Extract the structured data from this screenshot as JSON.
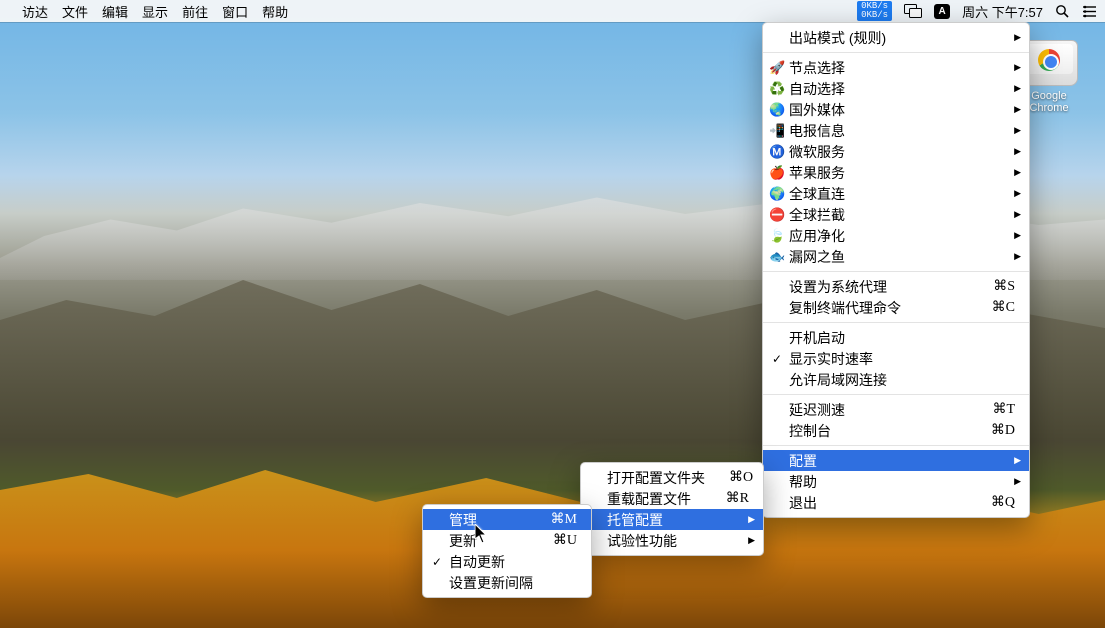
{
  "menubar": {
    "apple": "",
    "items": [
      "访达",
      "文件",
      "编辑",
      "显示",
      "前往",
      "窗口",
      "帮助"
    ],
    "net_up": "0KB/s",
    "net_down": "0KB/s",
    "input_method": "A",
    "clock": "周六 下午7:57"
  },
  "desktop_icon": {
    "label": "Google Chrome"
  },
  "main_menu": {
    "outbound": "出站模式 (规则)",
    "nodes": [
      {
        "icon": "🚀",
        "label": "节点选择"
      },
      {
        "icon": "♻️",
        "label": "自动选择"
      },
      {
        "icon": "🌏",
        "label": "国外媒体"
      },
      {
        "icon": "📲",
        "label": "电报信息"
      },
      {
        "icon": "Ⓜ️",
        "label": "微软服务"
      },
      {
        "icon": "🍎",
        "label": "苹果服务"
      },
      {
        "icon": "🌍",
        "label": "全球直连"
      },
      {
        "icon": "⛔",
        "label": "全球拦截"
      },
      {
        "icon": "🍃",
        "label": "应用净化"
      },
      {
        "icon": "🐟",
        "label": "漏网之鱼"
      }
    ],
    "set_system_proxy": {
      "label": "设置为系统代理",
      "shortcut": "⌘S"
    },
    "copy_cmd": {
      "label": "复制终端代理命令",
      "shortcut": "⌘C"
    },
    "launch_at_login": "开机启动",
    "show_speed": "显示实时速率",
    "allow_lan": "允许局域网连接",
    "benchmark": {
      "label": "延迟测速",
      "shortcut": "⌘T"
    },
    "dashboard": {
      "label": "控制台",
      "shortcut": "⌘D"
    },
    "config": "配置",
    "help": "帮助",
    "quit": {
      "label": "退出",
      "shortcut": "⌘Q"
    }
  },
  "config_submenu": {
    "open_folder": {
      "label": "打开配置文件夹",
      "shortcut": "⌘O"
    },
    "reload": {
      "label": "重载配置文件",
      "shortcut": "⌘R"
    },
    "managed": "托管配置",
    "experimental": "试验性功能"
  },
  "managed_submenu": {
    "manage": {
      "label": "管理",
      "shortcut": "⌘M"
    },
    "update": {
      "label": "更新",
      "shortcut": "⌘U"
    },
    "auto_update": "自动更新",
    "set_interval": "设置更新间隔"
  }
}
